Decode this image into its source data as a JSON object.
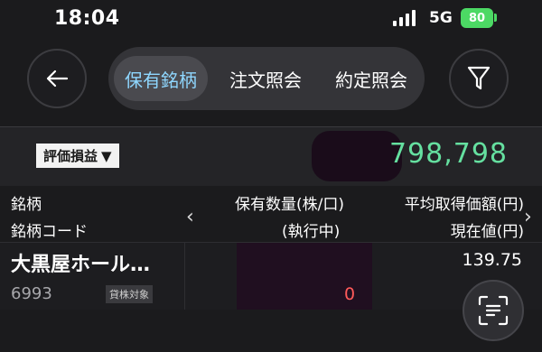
{
  "status_bar": {
    "time": "18:04",
    "network": "5G",
    "battery": "80"
  },
  "nav": {
    "tabs": [
      {
        "label": "保有銘柄",
        "active": true
      },
      {
        "label": "注文照会",
        "active": false
      },
      {
        "label": "約定照会",
        "active": false
      }
    ]
  },
  "summary": {
    "label": "評価損益",
    "value": "798,798"
  },
  "table": {
    "headers": {
      "name": "銘柄",
      "code": "銘柄コード",
      "quantity": "保有数量(株/口)",
      "executing": "(執行中)",
      "avg_price": "平均取得価額(円)",
      "current_price": "現在値(円)"
    },
    "rows": [
      {
        "name": "大黒屋ホール…",
        "code": "6993",
        "badge": "貸株対象",
        "executing_qty": "0",
        "current_price": "139.75"
      }
    ]
  },
  "colors": {
    "active_tab": "#8fd7ff",
    "profit": "#65e0a0",
    "loss": "#ff5a5a",
    "battery": "#4cd964"
  }
}
